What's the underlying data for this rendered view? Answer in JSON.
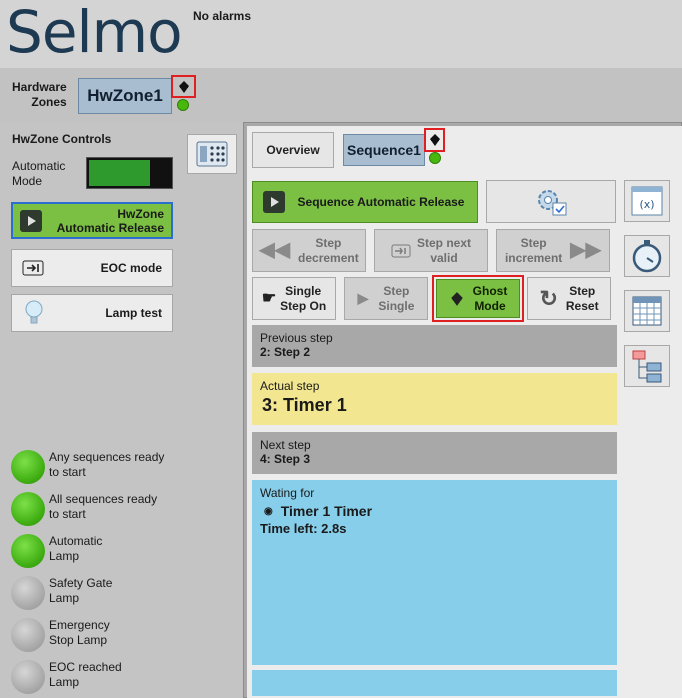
{
  "header": {
    "logo": "Selmo",
    "alarms": "No alarms"
  },
  "hardware": {
    "label_line1": "Hardware",
    "label_line2": "Zones",
    "zone": "HwZone1"
  },
  "controls": {
    "title": "HwZone Controls",
    "auto_mode_line1": "Automatic",
    "auto_mode_line2": "Mode",
    "release_line1": "HwZone",
    "release_line2": "Automatic Release",
    "eoc_mode": "EOC mode",
    "lamp_test": "Lamp test"
  },
  "lamps": [
    {
      "l1": "Any sequences ready",
      "l2": "to start",
      "state": "on"
    },
    {
      "l1": "All sequences ready",
      "l2": "to start",
      "state": "on"
    },
    {
      "l1": "Automatic",
      "l2": "Lamp",
      "state": "on"
    },
    {
      "l1": "Safety Gate",
      "l2": "Lamp",
      "state": "off"
    },
    {
      "l1": "Emergency",
      "l2": "Stop Lamp",
      "state": "off"
    },
    {
      "l1": "EOC reached",
      "l2": "Lamp",
      "state": "off"
    }
  ],
  "tabs": {
    "overview": "Overview",
    "sequence": "Sequence1"
  },
  "buttons": {
    "seq_release": "Sequence Automatic Release",
    "step_dec_1": "Step",
    "step_dec_2": "decrement",
    "step_next_1": "Step next",
    "step_next_2": "valid",
    "step_inc_1": "Step",
    "step_inc_2": "increment",
    "single_on_1": "Single",
    "single_on_2": "Step On",
    "step_single_1": "Step",
    "step_single_2": "Single",
    "ghost_1": "Ghost",
    "ghost_2": "Mode",
    "reset_1": "Step",
    "reset_2": "Reset"
  },
  "steps": {
    "prev_label": "Previous step",
    "prev_value": "2: Step 2",
    "actual_label": "Actual step",
    "actual_value": "3: Timer 1",
    "next_label": "Next step",
    "next_value": "4: Step 3",
    "wait_label": "Wating for",
    "wait_value": "Timer 1 Timer",
    "time_left": "Time left: 2.8s"
  },
  "colors": {
    "accent_green": "#7bc043",
    "actual_yellow": "#f2e690",
    "waiting_blue": "#87ceea",
    "step_gray": "#a8a8a8"
  }
}
